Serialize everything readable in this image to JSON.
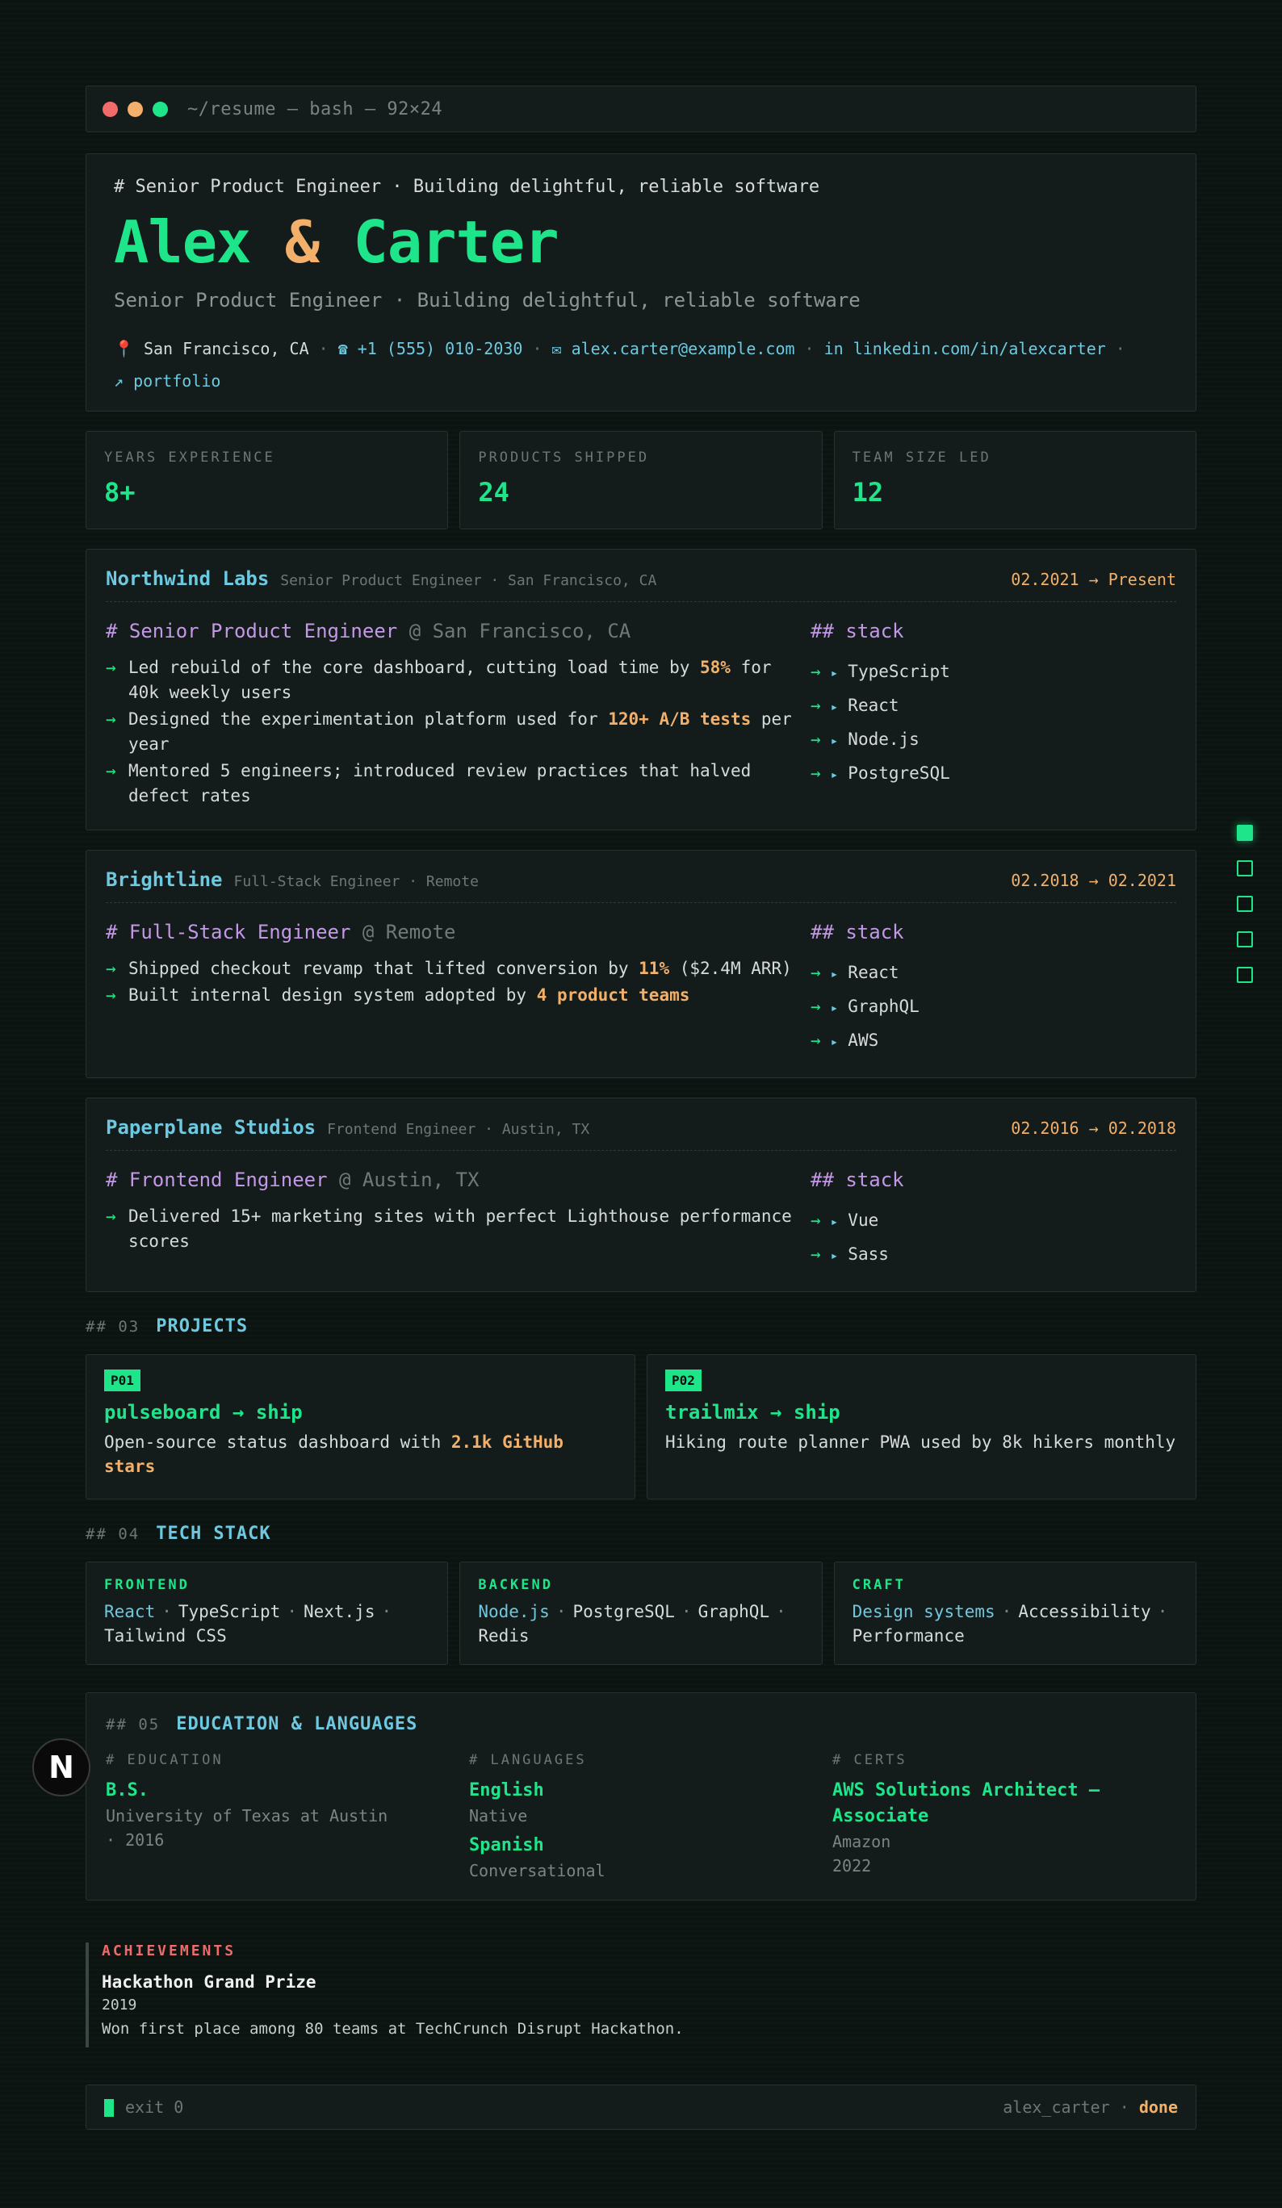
{
  "window": {
    "title": "~/resume — bash — 92×24",
    "dots": [
      "#f26b6b",
      "#f2b06b",
      "#1fe58a"
    ]
  },
  "header": {
    "comment": "# Senior Product Engineer · Building delightful, reliable software",
    "first": "Alex",
    "amp": "&",
    "last": "Carter",
    "subtitle": "Senior Product Engineer · Building delightful, reliable software",
    "location": "📍 San Francisco, CA",
    "phone": "☎ +1 (555) 010-2030",
    "email": "✉ alex.carter@example.com",
    "linkedin": "in linkedin.com/in/alexcarter",
    "portfolio": "↗ portfolio"
  },
  "stats": [
    {
      "label": "YEARS EXPERIENCE",
      "value": "8+"
    },
    {
      "label": "PRODUCTS SHIPPED",
      "value": "24"
    },
    {
      "label": "TEAM SIZE LED",
      "value": "12"
    }
  ],
  "jobs": [
    {
      "company": "Northwind Labs",
      "meta": "Senior Product Engineer · San Francisco, CA",
      "dates": "02.2021 → Present",
      "role": "# Senior Product Engineer",
      "at": "@ San Francisco, CA",
      "bullets": [
        {
          "pre": "Led rebuild of the core dashboard, cutting load time by ",
          "hl": "58%",
          "post": " for 40k weekly users"
        },
        {
          "pre": "Designed the experimentation platform used for ",
          "hl": "120+ A/B tests",
          "post": " per year"
        },
        {
          "pre": "Mentored 5 engineers; introduced review practices that halved defect rates",
          "hl": "",
          "post": ""
        }
      ],
      "stack": [
        "TypeScript",
        "React",
        "Node.js",
        "PostgreSQL"
      ]
    },
    {
      "company": "Brightline",
      "meta": "Full-Stack Engineer · Remote",
      "dates": "02.2018 → 02.2021",
      "role": "# Full-Stack Engineer",
      "at": "@ Remote",
      "bullets": [
        {
          "pre": "Shipped checkout revamp that lifted conversion by ",
          "hl": "11%",
          "post": " ($2.4M ARR)"
        },
        {
          "pre": "Built internal design system adopted by ",
          "hl": "4 product teams",
          "post": ""
        }
      ],
      "stack": [
        "React",
        "GraphQL",
        "AWS"
      ]
    },
    {
      "company": "Paperplane Studios",
      "meta": "Frontend Engineer · Austin, TX",
      "dates": "02.2016 → 02.2018",
      "role": "# Frontend Engineer",
      "at": "@ Austin, TX",
      "bullets": [
        {
          "pre": "Delivered 15+ marketing sites with perfect Lighthouse performance scores",
          "hl": "",
          "post": ""
        }
      ],
      "stack": [
        "Vue",
        "Sass"
      ]
    }
  ],
  "stack_heading": "## stack",
  "projects_section": {
    "num": "## 03",
    "name": "PROJECTS"
  },
  "projects": [
    {
      "tag": "P01",
      "name": "pulseboard → ship",
      "pre": "Open-source status dashboard with ",
      "hl": "2.1k GitHub stars",
      "post": ""
    },
    {
      "tag": "P02",
      "name": "trailmix → ship",
      "pre": "Hiking route planner PWA used by 8k hikers monthly",
      "hl": "",
      "post": ""
    }
  ],
  "tech_section": {
    "num": "## 04",
    "name": "TECH STACK"
  },
  "tech": [
    {
      "title": "FRONTEND",
      "items": [
        "React",
        "TypeScript",
        "Next.js",
        "Tailwind CSS"
      ]
    },
    {
      "title": "BACKEND",
      "items": [
        "Node.js",
        "PostgreSQL",
        "GraphQL",
        "Redis"
      ]
    },
    {
      "title": "CRAFT",
      "items": [
        "Design systems",
        "Accessibility",
        "Performance"
      ]
    }
  ],
  "edu_section": {
    "num": "## 05",
    "name": "EDUCATION & LANGUAGES"
  },
  "education": {
    "heading": "# EDUCATION",
    "degree": "B.S.",
    "school": "University of Texas at Austin · 2016"
  },
  "languages": {
    "heading": "# LANGUAGES",
    "items": [
      {
        "name": "English",
        "level": "Native"
      },
      {
        "name": "Spanish",
        "level": "Conversational"
      }
    ]
  },
  "certs": {
    "heading": "# CERTS",
    "name": "AWS Solutions Architect – Associate",
    "issuer": "Amazon",
    "year": "2022"
  },
  "achievements": {
    "heading": "ACHIEVEMENTS",
    "title": "Hackathon Grand Prize",
    "year": "2019",
    "desc": "Won first place among 80 teams at TechCrunch Disrupt Hackathon."
  },
  "footer": {
    "status": "exit 0",
    "user": "alex_carter · ",
    "state": "done"
  },
  "badge": "N"
}
